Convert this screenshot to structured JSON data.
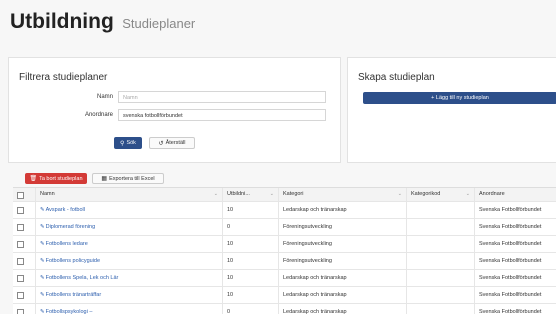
{
  "header": {
    "title": "Utbildning",
    "subtitle": "Studieplaner"
  },
  "filter": {
    "title": "Filtrera studieplaner",
    "name_label": "Namn",
    "name_placeholder": "Namn",
    "organizer_label": "Anordnare",
    "organizer_value": "svenska fotbollförbundet",
    "search_label": "Sök",
    "reset_label": "Återställ"
  },
  "create": {
    "title": "Skapa studieplan",
    "add_label": "+ Lägg till ny studieplan"
  },
  "toolbar": {
    "delete_label": "Ta bort studieplan",
    "export_label": "Exportera till Excel"
  },
  "table": {
    "columns": [
      "Namn",
      "Utbildni...",
      "Kategori",
      "Kategorikod",
      "Anordnare"
    ],
    "rows": [
      {
        "name": "Avspark - fotboll",
        "hours": "10",
        "category": "Ledarskap och tränarskap",
        "code": "",
        "organizer": "Svenska Fotbollförbundet"
      },
      {
        "name": "Diplomerad förening",
        "hours": "0",
        "category": "Föreningsutveckling",
        "code": "",
        "organizer": "Svenska Fotbollförbundet"
      },
      {
        "name": "Fotbollens ledare",
        "hours": "10",
        "category": "Föreningsutveckling",
        "code": "",
        "organizer": "Svenska Fotbollförbundet"
      },
      {
        "name": "Fotbollens policyguide",
        "hours": "10",
        "category": "Föreningsutveckling",
        "code": "",
        "organizer": "Svenska Fotbollförbundet"
      },
      {
        "name": "Fotbollens Spela, Lek och Lär",
        "hours": "10",
        "category": "Ledarskap och tränarskap",
        "code": "",
        "organizer": "Svenska Fotbollförbundet"
      },
      {
        "name": "Fotbollens tränarträffar",
        "hours": "10",
        "category": "Ledarskap och tränarskap",
        "code": "",
        "organizer": "Svenska Fotbollförbundet"
      },
      {
        "name": "Fotbollspsykologi –",
        "hours": "0",
        "category": "Ledarskap och tränarskap",
        "code": "",
        "organizer": "Svenska Fotbollförbundet"
      }
    ]
  }
}
